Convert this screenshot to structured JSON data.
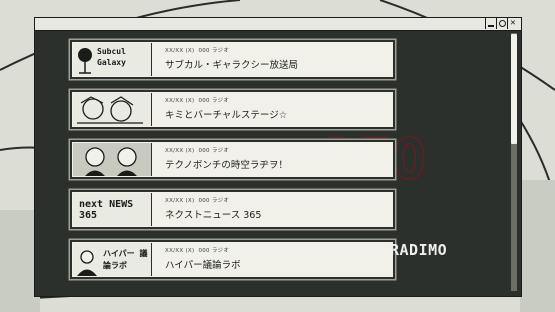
{
  "window": {
    "controls": {
      "minimize": "",
      "maximize": "",
      "close": "✕"
    },
    "logo": "RADIMO"
  },
  "stations": [
    {
      "meta_date": "XX/XX (X)",
      "meta_time": "000 ラジオ",
      "title": "サブカル・ギャラクシー放送局",
      "thumb_text": "Subcul Galaxy"
    },
    {
      "meta_date": "XX/XX (X)",
      "meta_time": "000 ラジオ",
      "title": "キミとバーチャルステージ☆",
      "thumb_text": ""
    },
    {
      "meta_date": "XX/XX (X)",
      "meta_time": "000 ラジオ",
      "title": "テクノボンチの時空ラヂヲ！",
      "thumb_text": ""
    },
    {
      "meta_date": "XX/XX (X)",
      "meta_time": "000 ラジオ",
      "title": "ネクストニュース 365",
      "thumb_text": "next NEWS 365"
    },
    {
      "meta_date": "XX/XX (X)",
      "meta_time": "000 ラジオ",
      "title": "ハイパー議論ラボ",
      "thumb_text": "ハイパー 議論ラボ"
    }
  ],
  "colors": {
    "window_bg": "#2c302c",
    "item_bg": "#f1f1e9",
    "titlebar_bg": "#e7e8e1",
    "accent_red": "#8e1f22"
  }
}
